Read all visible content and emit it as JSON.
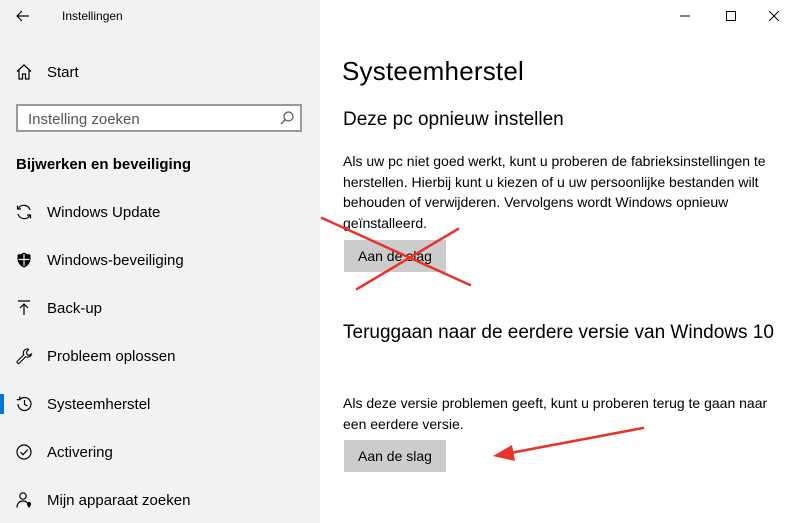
{
  "window": {
    "app_title": "Instellingen",
    "controls": [
      "minimize-icon",
      "maximize-icon",
      "close-icon"
    ]
  },
  "sidebar": {
    "home_label": "Start",
    "search_placeholder": "Instelling zoeken",
    "section_heading": "Bijwerken en beveiliging",
    "items": [
      {
        "label": "Windows Update",
        "icon": "sync-icon"
      },
      {
        "label": "Windows-beveiliging",
        "icon": "shield-icon"
      },
      {
        "label": "Back-up",
        "icon": "backup-arrow-icon"
      },
      {
        "label": "Probleem oplossen",
        "icon": "wrench-icon"
      },
      {
        "label": "Systeemherstel",
        "icon": "history-icon",
        "active": true
      },
      {
        "label": "Activering",
        "icon": "check-circle-icon"
      },
      {
        "label": "Mijn apparaat zoeken",
        "icon": "person-location-icon"
      }
    ],
    "accent_color": "#0078d7"
  },
  "main": {
    "title": "Systeemherstel",
    "reset": {
      "title": "Deze pc opnieuw instellen",
      "description": "Als uw pc niet goed werkt, kunt u proberen de fabrieksinstellingen te herstellen. Hierbij kunt u kiezen of u uw persoonlijke bestanden wilt behouden of verwijderen. Vervolgens wordt Windows opnieuw geïnstalleerd.",
      "button_label": "Aan de slag"
    },
    "rollback": {
      "title": "Teruggaan naar de eerdere versie van Windows 10",
      "description": "Als deze versie problemen geeft, kunt u proberen terug te gaan naar een eerdere versie.",
      "button_label": "Aan de slag"
    }
  },
  "annotations": {
    "color": "#e8322a",
    "marks": [
      "cross-out",
      "arrow"
    ]
  }
}
